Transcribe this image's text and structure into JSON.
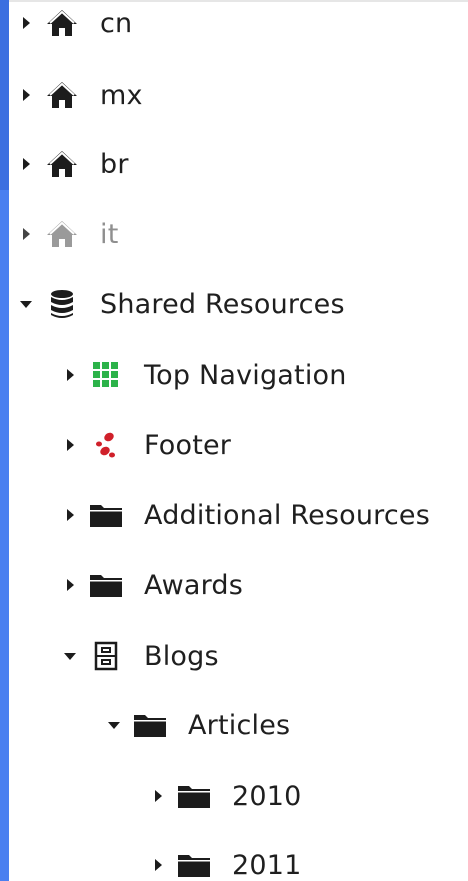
{
  "tree": {
    "items": [
      {
        "label": "cn",
        "expanded": false,
        "icon": "home-icon"
      },
      {
        "label": "mx",
        "expanded": false,
        "icon": "home-icon"
      },
      {
        "label": "br",
        "expanded": false,
        "icon": "home-icon"
      },
      {
        "label": "it",
        "expanded": false,
        "icon": "home-icon",
        "disabled": true
      },
      {
        "label": "Shared Resources",
        "expanded": true,
        "icon": "database-icon"
      },
      {
        "label": "Top Navigation",
        "expanded": false,
        "icon": "grid-icon"
      },
      {
        "label": "Footer",
        "expanded": false,
        "icon": "footprints-icon"
      },
      {
        "label": "Additional Resources",
        "expanded": false,
        "icon": "folder-icon"
      },
      {
        "label": "Awards",
        "expanded": false,
        "icon": "folder-icon"
      },
      {
        "label": "Blogs",
        "expanded": true,
        "icon": "archive-icon"
      },
      {
        "label": "Articles",
        "expanded": true,
        "icon": "folder-icon"
      },
      {
        "label": "2010",
        "expanded": false,
        "icon": "folder-icon"
      },
      {
        "label": "2011",
        "expanded": false,
        "icon": "folder-icon"
      }
    ]
  },
  "colors": {
    "accent_bar": "#4a7ff0",
    "icon_dark": "#1c1c1c",
    "icon_muted": "#9a9a9a",
    "grid_green": "#2cb34a",
    "footer_red": "#d0202a"
  }
}
